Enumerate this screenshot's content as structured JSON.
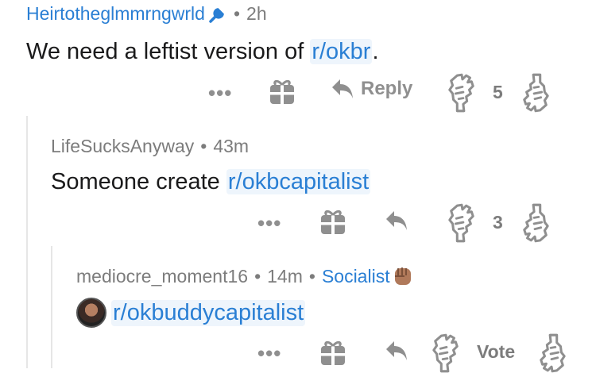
{
  "comments": [
    {
      "username": "Heirtotheglmmrngwrld",
      "user_icon": "wrench-icon",
      "separator": "•",
      "time": "2h",
      "text_prefix": "We need a leftist version of ",
      "link_text": "r/okbr",
      "text_suffix": ".",
      "more_label": "•••",
      "reply_label": "Reply",
      "vote_count": "5"
    },
    {
      "username": "LifeSucksAnyway",
      "separator": "•",
      "time": "43m",
      "text_prefix": "Someone create ",
      "link_text": "r/okbcapitalist",
      "more_label": "•••",
      "vote_count": "3"
    },
    {
      "username": "mediocre_moment16",
      "separator": "•",
      "time": "14m",
      "separator2": "•",
      "flair": "Socialist",
      "flair_icon": "raised-fist-emoji",
      "link_text": "r/okbuddycapitalist",
      "more_label": "•••",
      "vote_label": "Vote"
    }
  ],
  "colors": {
    "link": "#2a7fd4",
    "icon_gray": "#8f8f8f",
    "meta_gray": "#7c7c7c",
    "thread_line": "#e6e6e6"
  }
}
